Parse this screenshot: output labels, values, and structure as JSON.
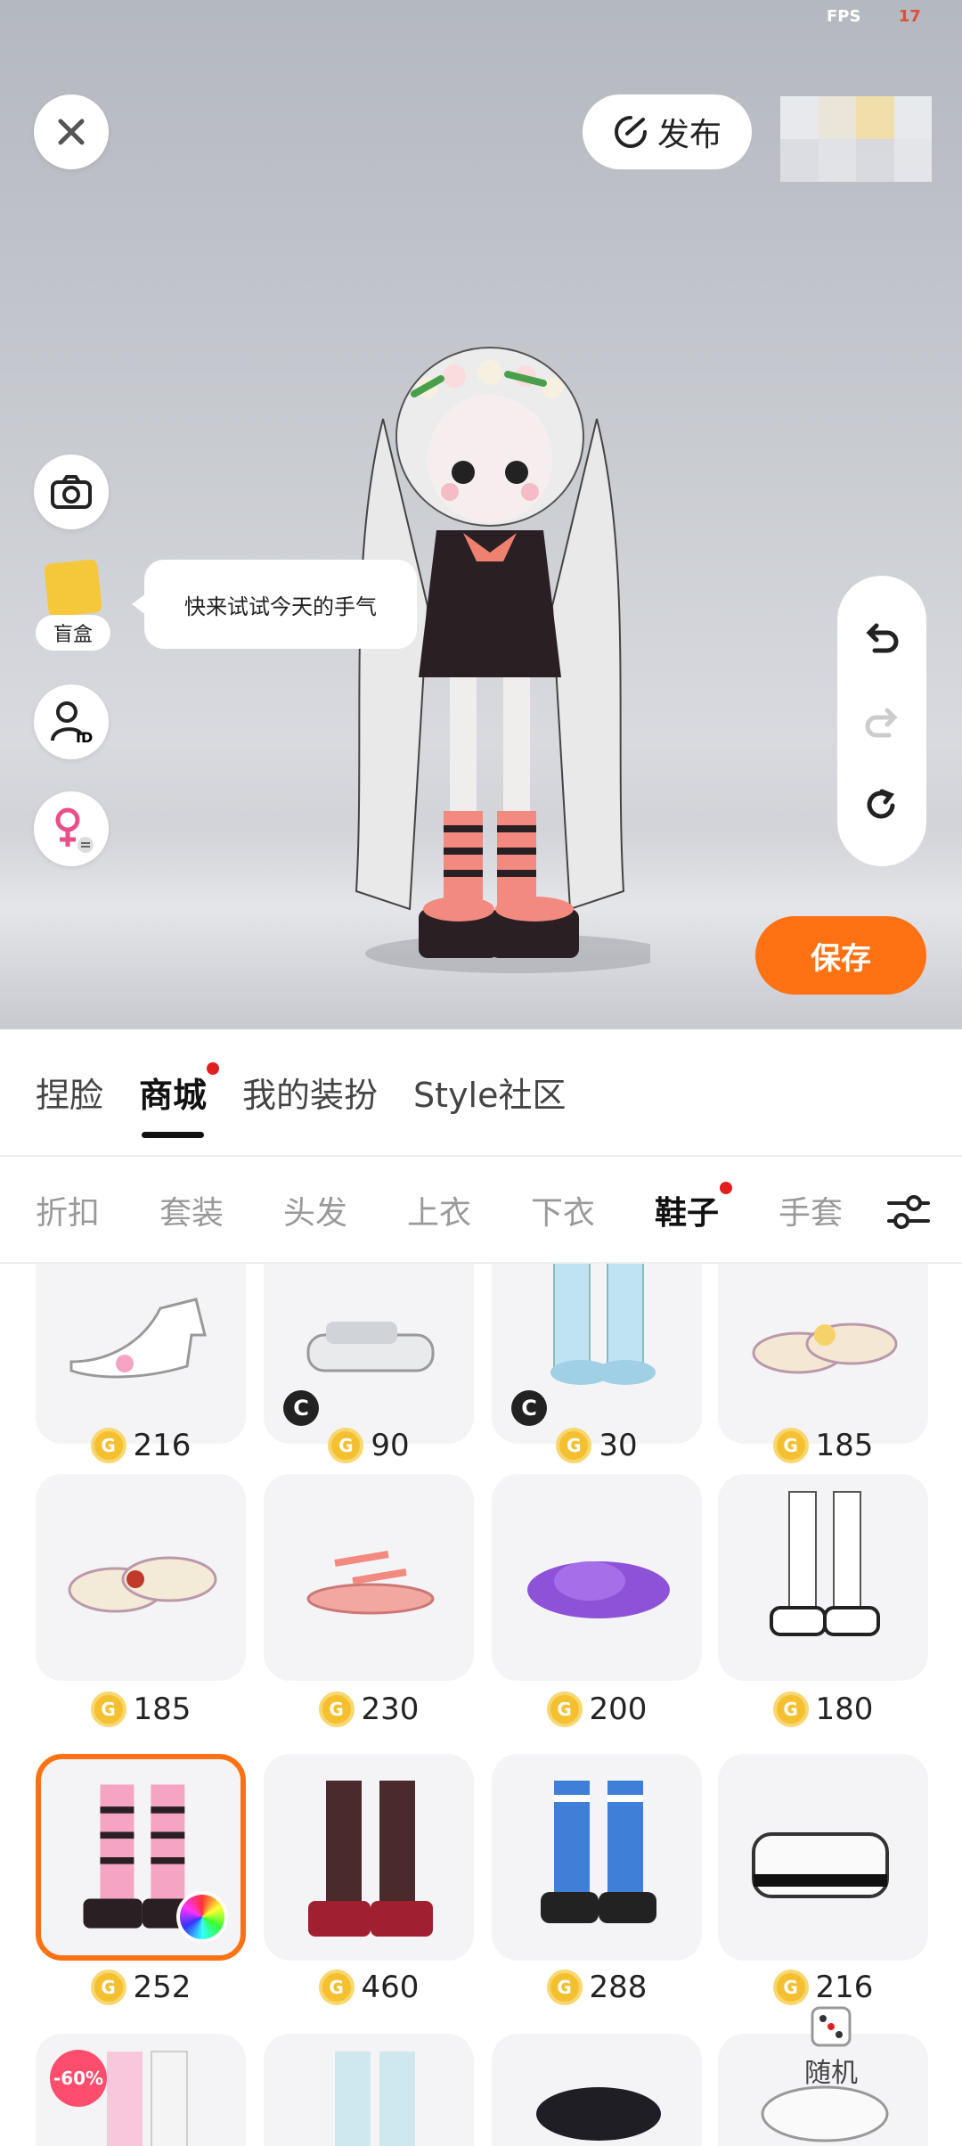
{
  "status": {
    "fps_label": "FPS",
    "fps_value": "17"
  },
  "top_bar": {
    "publish_label": "发布"
  },
  "left_tools": {
    "blindbox_label": "盲盒"
  },
  "tip_bubble": "快来试试今天的手气",
  "save_label": "保存",
  "mode_tabs": [
    {
      "label": "捏脸"
    },
    {
      "label": "商城"
    },
    {
      "label": "我的装扮"
    },
    {
      "label": "Style社区"
    }
  ],
  "category_tabs": [
    {
      "label": "折扣"
    },
    {
      "label": "套装"
    },
    {
      "label": "头发"
    },
    {
      "label": "上衣"
    },
    {
      "label": "下衣"
    },
    {
      "label": "鞋子"
    },
    {
      "label": "手套"
    }
  ],
  "items": [
    {
      "price": "216"
    },
    {
      "price": "90"
    },
    {
      "price": "30"
    },
    {
      "price": "185"
    },
    {
      "price": "185"
    },
    {
      "price": "230"
    },
    {
      "price": "200"
    },
    {
      "price": "180"
    },
    {
      "price": "252"
    },
    {
      "price": "460"
    },
    {
      "price": "288"
    },
    {
      "price": "216"
    },
    {
      "badge": "-60%"
    },
    {},
    {},
    {}
  ],
  "random_label": "随机",
  "colors": {
    "accent": "#ff7214",
    "coin": "#f4c030",
    "badge_dot": "#e02020"
  },
  "icons": [
    "close-icon",
    "publish-icon",
    "camera-icon",
    "blindbox-icon",
    "user-id-icon",
    "gender-switch-icon",
    "undo-icon",
    "redo-icon",
    "reset-icon",
    "filter-icon",
    "coin-icon",
    "creator-badge-icon",
    "color-wheel-icon",
    "dice-icon"
  ]
}
